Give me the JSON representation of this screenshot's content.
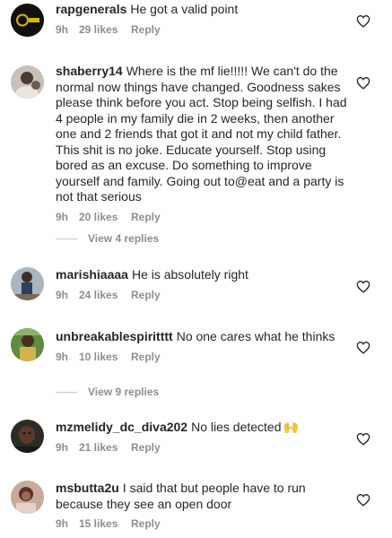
{
  "comments": [
    {
      "username": "rapgenerals",
      "text": "He got a valid point",
      "time": "9h",
      "likes": "29 likes",
      "reply": "Reply",
      "avatar_bg": "#111111",
      "avatar_accent": "#d4b800"
    },
    {
      "username": "shaberry14",
      "text": "Where is the mf lie!!!!! We can't do the normal now things have changed. Goodness sakes please think before you act. Stop being selfish.  I had 4 people in my family die in 2 weeks, then another one and 2 friends that got it and not my child father. This shit is no joke. Educate yourself. Stop using bored as an excuse. Do something to improve yourself and family. Going out to@eat and a party is not that serious",
      "time": "9h",
      "likes": "20 likes",
      "reply": "Reply",
      "view_replies": "View 4 replies",
      "avatar_bg": "#b9b2ab"
    },
    {
      "username": "marishiaaaa",
      "text": "He is absolutely right",
      "time": "9h",
      "likes": "24 likes",
      "reply": "Reply",
      "avatar_bg": "#9aa9b4"
    },
    {
      "username": "unbreakablespiritttt",
      "text": "No one cares what he thinks",
      "time": "9h",
      "likes": "10 likes",
      "reply": "Reply",
      "view_replies": "View 9 replies",
      "avatar_bg": "#6a8b4b"
    },
    {
      "username": "mzmelidy_dc_diva202",
      "text": "No lies detected",
      "emoji": "🙌",
      "time": "9h",
      "likes": "21 likes",
      "reply": "Reply",
      "avatar_bg": "#3a3530"
    },
    {
      "username": "msbutta2u",
      "text": "I said that but people have to run because they see an open door",
      "time": "9h",
      "likes": "15 likes",
      "reply": "Reply",
      "avatar_bg": "#8a5a4d"
    }
  ],
  "colors": {
    "text": "#262626",
    "meta": "#8e8e8e",
    "heart_stroke": "#262626",
    "divider": "#c7c7c7"
  },
  "icons": {
    "like": "heart-outline-icon"
  }
}
